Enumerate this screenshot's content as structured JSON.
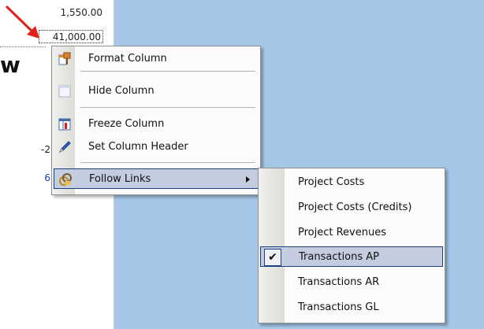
{
  "sheet": {
    "cells": [
      "1,550.00",
      "41,000.00",
      "-2",
      "6"
    ],
    "side_letter": "w"
  },
  "context_menu": {
    "items": [
      {
        "label": "Format Column",
        "icon": "format-column-icon"
      },
      {
        "label": "Hide Column",
        "icon": "hide-column-icon"
      },
      {
        "label": "Freeze Column",
        "icon": "freeze-column-icon"
      },
      {
        "label": "Set Column Header",
        "icon": "pencil-icon"
      },
      {
        "label": "Follow Links",
        "icon": "follow-links-icon",
        "has_submenu": true,
        "highlighted": true
      }
    ]
  },
  "follow_links_submenu": {
    "items": [
      {
        "label": "Project Costs"
      },
      {
        "label": "Project Costs (Credits)"
      },
      {
        "label": "Project Revenues"
      },
      {
        "label": "Transactions AP",
        "checked": true,
        "highlighted": true
      },
      {
        "label": "Transactions AR"
      },
      {
        "label": "Transactions GL"
      }
    ],
    "check_glyph": "✔"
  },
  "colors": {
    "desktop_bg": "#a6c6e8",
    "highlight_bg": "#c4cce0",
    "highlight_border": "#1c3f80",
    "arrow": "#e0201a",
    "link_value": "#1a3fbf"
  }
}
